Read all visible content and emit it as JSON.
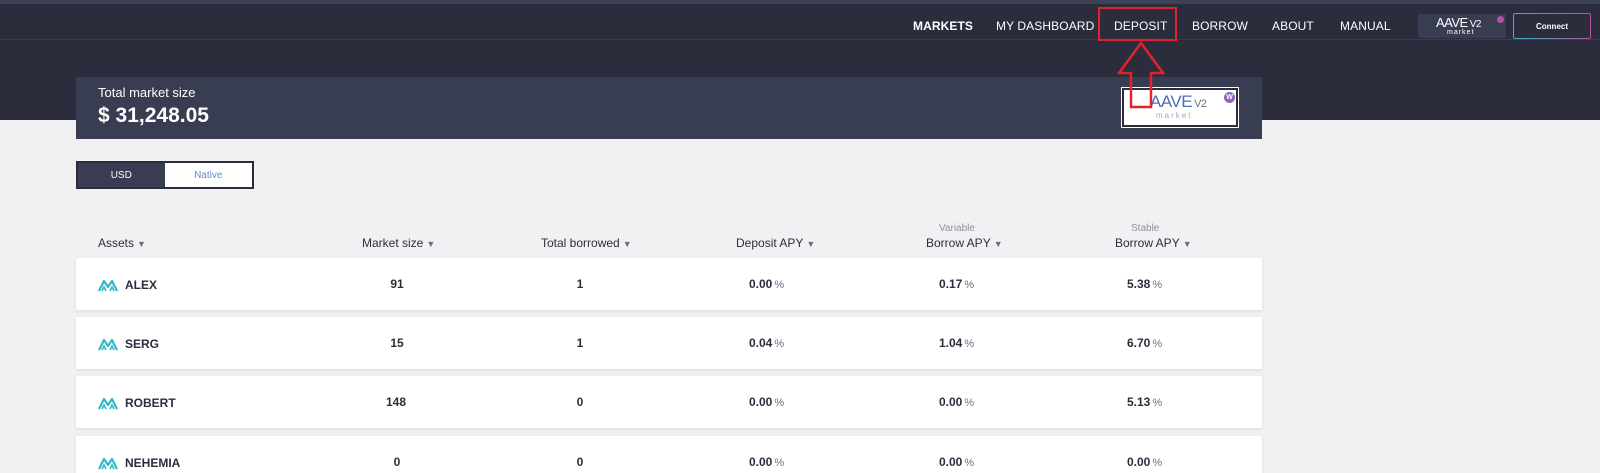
{
  "header": {
    "nav": [
      {
        "label": "MARKETS",
        "active": true
      },
      {
        "label": "MY DASHBOARD",
        "active": false
      },
      {
        "label": "DEPOSIT",
        "active": false
      },
      {
        "label": "BORROW",
        "active": false
      },
      {
        "label": "ABOUT",
        "active": false
      },
      {
        "label": "MANUAL",
        "active": false
      }
    ],
    "logo": {
      "main": "AAVE",
      "version": "V2",
      "sub": "market"
    },
    "connect_label": "Connect"
  },
  "market": {
    "label": "Total market size",
    "value": "$ 31,248.05",
    "badge": {
      "main": "AAVE",
      "version": "V2",
      "sub": "market",
      "dot": "W"
    }
  },
  "currency_toggle": {
    "options": [
      "USD",
      "Native"
    ],
    "selected": "Native"
  },
  "table": {
    "columns": [
      {
        "label": "Assets",
        "super": ""
      },
      {
        "label": "Market size",
        "super": ""
      },
      {
        "label": "Total borrowed",
        "super": ""
      },
      {
        "label": "Deposit APY",
        "super": ""
      },
      {
        "label": "Borrow APY",
        "super": "Variable"
      },
      {
        "label": "Borrow APY",
        "super": "Stable"
      }
    ],
    "sort_arrow": "▼",
    "pct_symbol": "%",
    "rows": [
      {
        "asset": "ALEX",
        "market_size": "91",
        "total_borrowed": "1",
        "deposit_apy": "0.00",
        "variable_apy": "0.17",
        "stable_apy": "5.38"
      },
      {
        "asset": "SERG",
        "market_size": "15",
        "total_borrowed": "1",
        "deposit_apy": "0.04",
        "variable_apy": "1.04",
        "stable_apy": "6.70"
      },
      {
        "asset": "ROBERT",
        "market_size": "148",
        "total_borrowed": "0",
        "deposit_apy": "0.00",
        "variable_apy": "0.00",
        "stable_apy": "5.13"
      },
      {
        "asset": "NEHEMIA",
        "market_size": "0",
        "total_borrowed": "0",
        "deposit_apy": "0.00",
        "variable_apy": "0.00",
        "stable_apy": "0.00"
      }
    ]
  },
  "colors": {
    "header_bg": "#2b2d3c",
    "panel_bg": "#383d51",
    "accent_gradient_start": "#37b3c9",
    "accent_gradient_end": "#b6509e",
    "annotation_red": "#e2232e"
  },
  "icons": {
    "asset": "aave-token-icon",
    "sort": "sort-down-icon",
    "annotation": "up-arrow-icon"
  }
}
